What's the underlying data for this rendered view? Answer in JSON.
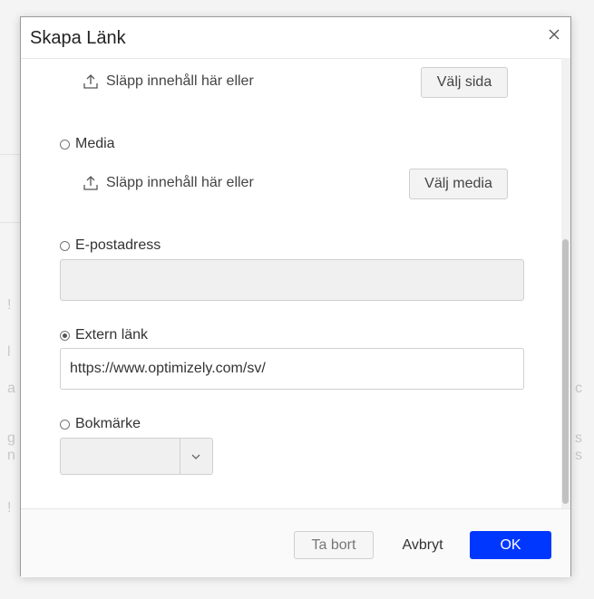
{
  "dialog": {
    "title": "Skapa Länk",
    "close_icon": "close-icon"
  },
  "page_section": {
    "drop_icon": "upload-icon",
    "drop_text": "Släpp innehåll här eller",
    "select_button": "Välj sida"
  },
  "media_section": {
    "label": "Media",
    "selected": false,
    "drop_icon": "upload-icon",
    "drop_text": "Släpp innehåll här eller",
    "select_button": "Välj media"
  },
  "email_section": {
    "label": "E-postadress",
    "selected": false,
    "value": ""
  },
  "external_section": {
    "label": "Extern länk",
    "selected": true,
    "value": "https://www.optimizely.com/sv/"
  },
  "bookmark_section": {
    "label": "Bokmärke",
    "selected": false,
    "value": "",
    "dropdown_icon": "chevron-down-icon"
  },
  "footer": {
    "remove_label": "Ta bort",
    "cancel_label": "Avbryt",
    "ok_label": "OK"
  },
  "colors": {
    "primary": "#0037ff",
    "border": "#cfcfcf",
    "disabled_bg": "#f0f0f0"
  }
}
